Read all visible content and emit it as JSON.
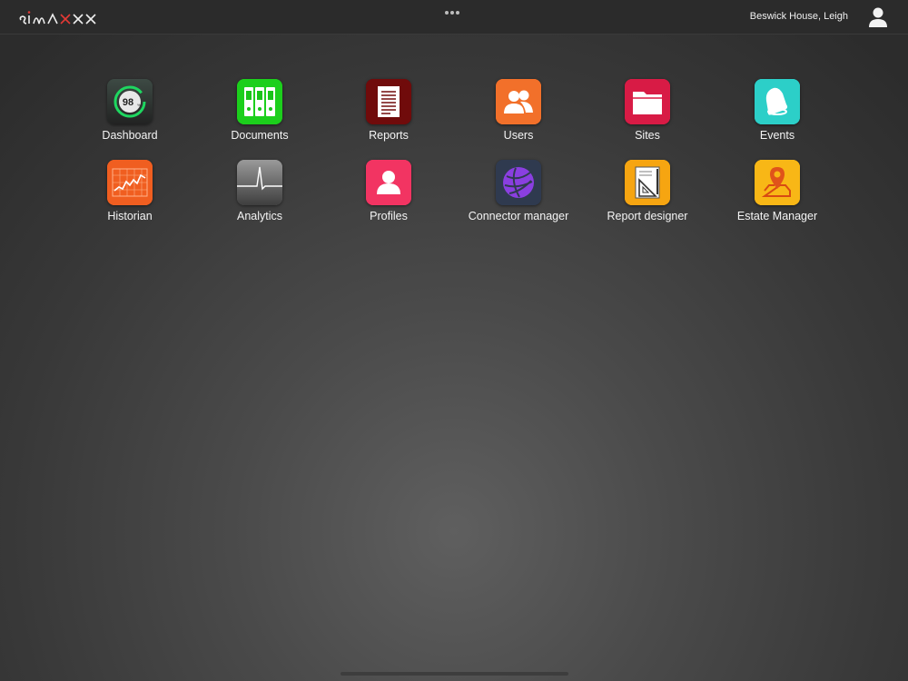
{
  "header": {
    "logo_text": "SIMAXX",
    "more_menu_icon": "ellipsis-icon",
    "user_name": "Beswick House, Leigh",
    "user_icon": "user-avatar-icon"
  },
  "apps": [
    {
      "label": "Dashboard",
      "icon": "gauge-icon",
      "gauge_value": "98",
      "gauge_unit": "%",
      "color": "#2b3a33"
    },
    {
      "label": "Documents",
      "icon": "binders-icon",
      "color": "#19c319"
    },
    {
      "label": "Reports",
      "icon": "document-icon",
      "color": "#6d0a0a"
    },
    {
      "label": "Users",
      "icon": "users-icon",
      "color": "#f26b26"
    },
    {
      "label": "Sites",
      "icon": "folder-icon",
      "color": "#d61a43"
    },
    {
      "label": "Events",
      "icon": "bell-icon",
      "color": "#27c5c5"
    },
    {
      "label": "Historian",
      "icon": "line-chart-icon",
      "color": "#ef5a1f"
    },
    {
      "label": "Analytics",
      "icon": "pulse-icon",
      "color": "#6b6b6b"
    },
    {
      "label": "Profiles",
      "icon": "profile-icon",
      "color": "#f0305f"
    },
    {
      "label": "Connector manager",
      "icon": "globe-icon",
      "color": "#2f3a4d"
    },
    {
      "label": "Report designer",
      "icon": "drafting-icon",
      "color": "#f5a40f"
    },
    {
      "label": "Estate Manager",
      "icon": "map-pin-icon",
      "color": "#f7b412"
    }
  ]
}
